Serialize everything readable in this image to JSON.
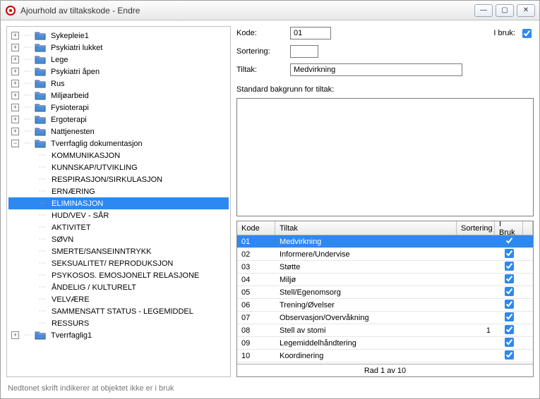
{
  "window": {
    "title": "Ajourhold av tiltakskode - Endre"
  },
  "tree": {
    "roots": [
      {
        "label": "Sykepleie1",
        "expanded": false,
        "hasChildren": true
      },
      {
        "label": "Psykiatri lukket",
        "expanded": false,
        "hasChildren": true
      },
      {
        "label": "Lege",
        "expanded": false,
        "hasChildren": true
      },
      {
        "label": "Psykiatri åpen",
        "expanded": false,
        "hasChildren": true
      },
      {
        "label": "Rus",
        "expanded": false,
        "hasChildren": true
      },
      {
        "label": "Miljøarbeid",
        "expanded": false,
        "hasChildren": true
      },
      {
        "label": "Fysioterapi",
        "expanded": false,
        "hasChildren": true
      },
      {
        "label": "Ergoterapi",
        "expanded": false,
        "hasChildren": true
      },
      {
        "label": "Nattjenesten",
        "expanded": false,
        "hasChildren": true
      },
      {
        "label": "Tverrfaglig dokumentasjon",
        "expanded": true,
        "hasChildren": true,
        "children": [
          {
            "label": "KOMMUNIKASJON"
          },
          {
            "label": "KUNNSKAP/UTVIKLING"
          },
          {
            "label": "RESPIRASJON/SIRKULASJON"
          },
          {
            "label": "ERNÆRING"
          },
          {
            "label": "ELIMINASJON",
            "selected": true
          },
          {
            "label": "HUD/VEV  - SÅR"
          },
          {
            "label": "AKTIVITET"
          },
          {
            "label": "SØVN"
          },
          {
            "label": "SMERTE/SANSEINNTRYKK"
          },
          {
            "label": "SEKSUALITET/ REPRODUKSJON"
          },
          {
            "label": "PSYKOSOS. EMOSJONELT RELASJONE"
          },
          {
            "label": "ÅNDELIG / KULTURELT"
          },
          {
            "label": "VELVÆRE"
          },
          {
            "label": "SAMMENSATT STATUS - LEGEMIDDEL"
          },
          {
            "label": "RESSURS"
          }
        ]
      },
      {
        "label": "Tverrfaglig1",
        "expanded": false,
        "hasChildren": true
      }
    ]
  },
  "form": {
    "kode_label": "Kode:",
    "kode_value": "01",
    "sortering_label": "Sortering:",
    "sortering_value": "",
    "tiltak_label": "Tiltak:",
    "tiltak_value": "Medvirkning",
    "ibruk_label": "I bruk:",
    "ibruk_checked": true,
    "standard_label": "Standard bakgrunn for tiltak:",
    "standard_value": ""
  },
  "grid": {
    "headers": {
      "kode": "Kode",
      "tiltak": "Tiltak",
      "sortering": "Sortering",
      "ibruk": "I Bruk"
    },
    "rows": [
      {
        "kode": "01",
        "tiltak": "Medvirkning",
        "sortering": "",
        "ibruk": true,
        "selected": true
      },
      {
        "kode": "02",
        "tiltak": "Informere/Undervise",
        "sortering": "",
        "ibruk": true
      },
      {
        "kode": "03",
        "tiltak": "Støtte",
        "sortering": "",
        "ibruk": true
      },
      {
        "kode": "04",
        "tiltak": "Miljø",
        "sortering": "",
        "ibruk": true
      },
      {
        "kode": "05",
        "tiltak": "Stell/Egenomsorg",
        "sortering": "",
        "ibruk": true
      },
      {
        "kode": "06",
        "tiltak": "Trening/Øvelser",
        "sortering": "",
        "ibruk": true
      },
      {
        "kode": "07",
        "tiltak": "Observasjon/Overvåkning",
        "sortering": "",
        "ibruk": true
      },
      {
        "kode": "08",
        "tiltak": "Stell av stomi",
        "sortering": "1",
        "ibruk": true
      },
      {
        "kode": "09",
        "tiltak": "Legemiddelhåndtering",
        "sortering": "",
        "ibruk": true
      },
      {
        "kode": "10",
        "tiltak": "Koordinering",
        "sortering": "",
        "ibruk": true
      }
    ],
    "status": "Rad 1 av 10"
  },
  "footer": {
    "note": "Nedtonet skrift indikerer at objektet ikke er i bruk"
  }
}
